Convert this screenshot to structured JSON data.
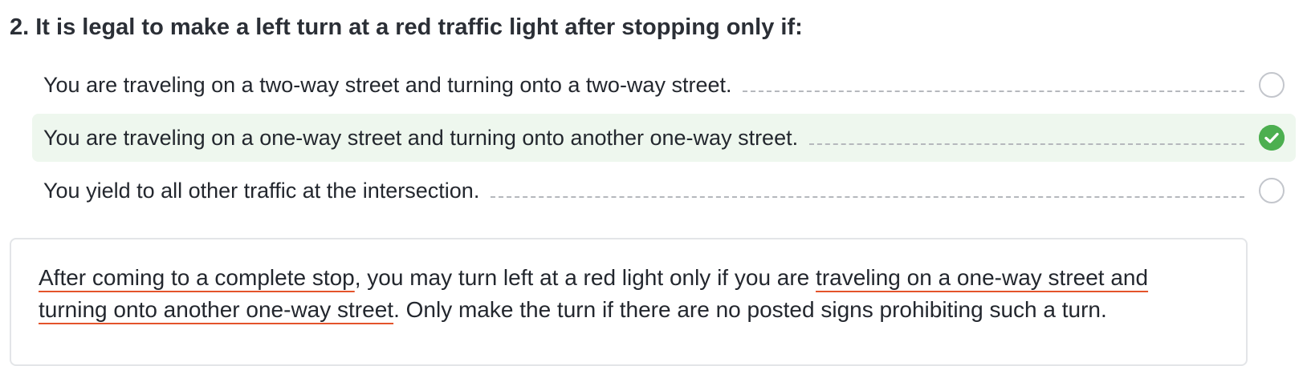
{
  "question": {
    "number": "2.",
    "text": "It is legal to make a left turn at a red traffic light after stopping only if:"
  },
  "options": [
    {
      "label": "You are traveling on a two-way street and turning onto a two-way street.",
      "state": "unselected"
    },
    {
      "label": "You are traveling on a one-way street and turning onto another one-way street.",
      "state": "correct"
    },
    {
      "label": "You yield to all other traffic at the intersection.",
      "state": "unselected"
    }
  ],
  "explanation": {
    "part1": "After coming to a complete stop",
    "part2": ", you may turn left at a red light only if you are ",
    "part3": "traveling on a one-way street and turning onto another one-way street",
    "part4": ". Only make the turn if there are no posted signs prohibiting such a turn."
  },
  "colors": {
    "correct_background": "#eef7ee",
    "correct_check": "#4caf50",
    "highlight_underline": "#e4532b"
  },
  "icons": {
    "correct": "check-circle-icon",
    "unselected": "radio-empty-icon"
  }
}
